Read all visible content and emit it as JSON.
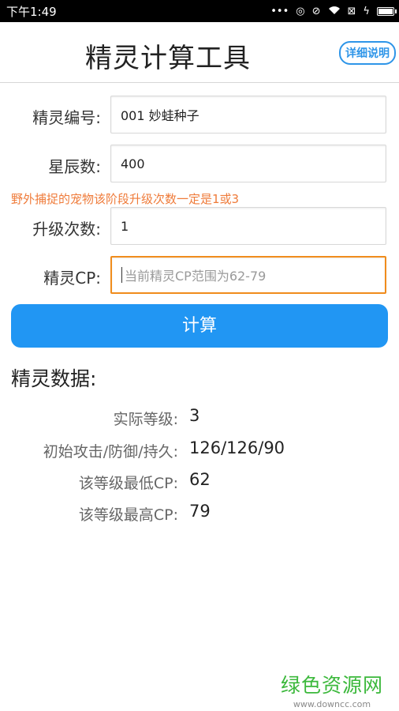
{
  "statusbar": {
    "time": "下午1:49",
    "icons": [
      "more-dots-icon",
      "sync-icon",
      "mute-icon",
      "wifi-icon",
      "no-sim-icon",
      "charging-icon",
      "battery-icon"
    ]
  },
  "header": {
    "title": "精灵计算工具",
    "help_label": "详细说明"
  },
  "form": {
    "id_label": "精灵编号:",
    "id_value": "001 妙蛙种子",
    "stardust_label": "星辰数:",
    "stardust_value": "400",
    "warning": "野外捕捉的宠物该阶段升级次数一定是1或3",
    "upgrades_label": "升级次数:",
    "upgrades_value": "1",
    "cp_label": "精灵CP:",
    "cp_placeholder": "当前精灵CP范围为62-79",
    "cp_value": ""
  },
  "calc_button": "计算",
  "results": {
    "title": "精灵数据:",
    "rows": [
      {
        "label": "实际等级:",
        "value": "3"
      },
      {
        "label": "初始攻击/防御/持久:",
        "value": "126/126/90"
      },
      {
        "label": "该等级最低CP:",
        "value": "62"
      },
      {
        "label": "该等级最高CP:",
        "value": "79"
      }
    ]
  },
  "watermark": {
    "name": "绿色资源网",
    "url": "www.downcc.com"
  },
  "colors": {
    "accent": "#2196f3",
    "warning": "#ef7b3a",
    "focus_border": "#f08c1c",
    "watermark": "#3bb83b"
  }
}
